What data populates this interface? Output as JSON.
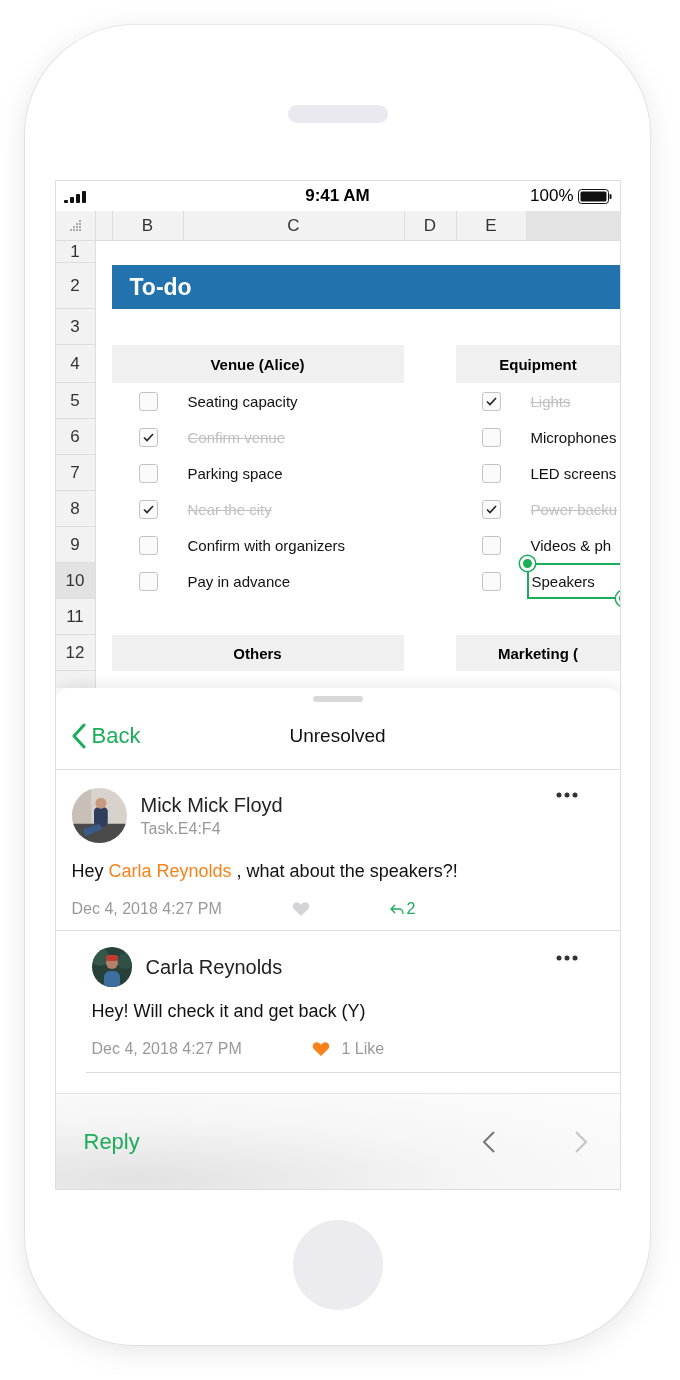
{
  "status_bar": {
    "time": "9:41 AM",
    "battery": "100%"
  },
  "sheet": {
    "columns": [
      {
        "label": "B",
        "selected": false
      },
      {
        "label": "C",
        "selected": false
      },
      {
        "label": "D",
        "selected": false
      },
      {
        "label": "E",
        "selected": false
      },
      {
        "selected": true
      }
    ],
    "rows": [
      {
        "label": "1",
        "selected": false
      },
      {
        "label": "2",
        "selected": false
      },
      {
        "label": "3",
        "selected": false
      },
      {
        "label": "4",
        "selected": false
      },
      {
        "label": "5",
        "selected": false
      },
      {
        "label": "6",
        "selected": false
      },
      {
        "label": "7",
        "selected": false
      },
      {
        "label": "8",
        "selected": false
      },
      {
        "label": "9",
        "selected": false
      },
      {
        "label": "10",
        "selected": true
      },
      {
        "label": "11",
        "selected": false
      },
      {
        "label": "12",
        "selected": false
      }
    ],
    "title": "To-do",
    "sections": [
      {
        "title": "Venue (Alice)",
        "items": [
          {
            "label": "Seating capacity",
            "checked": false,
            "selected": false
          },
          {
            "label": "Confirm venue",
            "checked": true,
            "selected": false
          },
          {
            "label": "Parking space",
            "checked": false,
            "selected": false
          },
          {
            "label": "Near the city",
            "checked": true,
            "selected": false
          },
          {
            "label": "Confirm with organizers",
            "checked": false,
            "selected": false
          },
          {
            "label": "Pay in advance",
            "checked": false,
            "selected": false
          }
        ]
      },
      {
        "title": "Equipment",
        "items": [
          {
            "label": "Lights",
            "checked": true,
            "selected": false
          },
          {
            "label": "Microphones",
            "checked": false,
            "selected": false
          },
          {
            "label": "LED screens",
            "checked": false,
            "selected": false
          },
          {
            "label": "Power backu",
            "checked": true,
            "selected": false
          },
          {
            "label": "Videos & ph",
            "checked": false,
            "selected": false
          },
          {
            "label": "Speakers",
            "checked": false,
            "selected": true
          }
        ]
      }
    ],
    "lower_sections": [
      {
        "title": "Others"
      },
      {
        "title": "Marketing ("
      }
    ]
  },
  "comments_panel": {
    "back": "Back",
    "title": "Unresolved",
    "comments": [
      {
        "author": "Mick Mick Floyd",
        "reference": "Task.E4:F4",
        "parts": [
          {
            "kind": "plain",
            "text": "Hey "
          },
          {
            "kind": "mention",
            "text": "Carla Reynolds"
          },
          {
            "kind": "plain",
            "text": " , what about the speakers?!"
          }
        ],
        "date": "Dec 4, 2018 4:27 PM",
        "liked": false,
        "reply_count": "2",
        "is_reply": false
      },
      {
        "author": "Carla Reynolds",
        "parts": [
          {
            "kind": "plain",
            "text": "Hey! Will check it and get back (Y)"
          }
        ],
        "date": "Dec 4, 2018 4:27 PM",
        "liked": true,
        "likes": "1 Like",
        "is_reply": true
      }
    ],
    "reply": "Reply",
    "prev_disabled": false,
    "next_disabled": true
  }
}
